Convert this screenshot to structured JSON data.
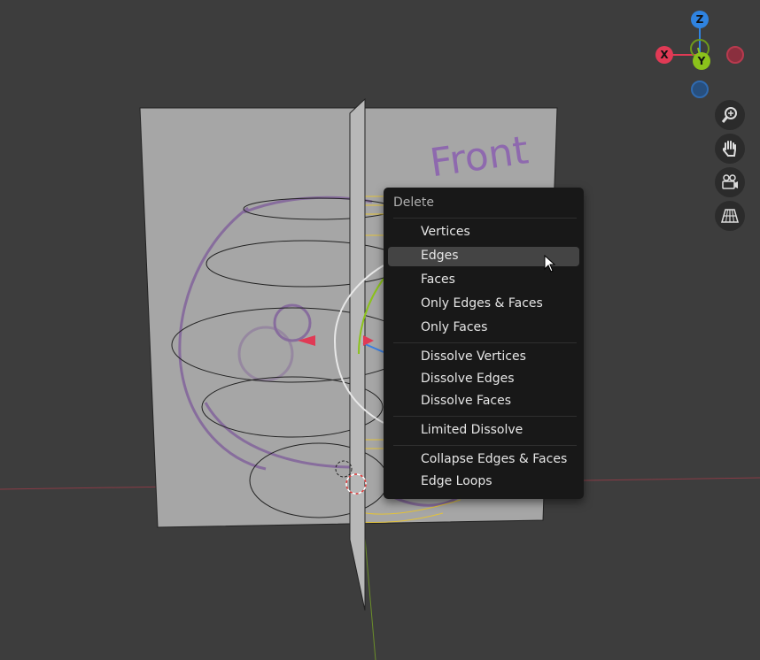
{
  "menu": {
    "title": "Delete",
    "items": [
      {
        "label": "Vertices"
      },
      {
        "label": "Edges",
        "highlighted": true
      },
      {
        "label": "Faces"
      },
      {
        "label": "Only Edges & Faces"
      },
      {
        "label": "Only Faces"
      },
      {
        "label": "Dissolve Vertices"
      },
      {
        "label": "Dissolve Edges"
      },
      {
        "label": "Dissolve Faces"
      },
      {
        "label": "Limited Dissolve"
      },
      {
        "label": "Collapse Edges & Faces"
      },
      {
        "label": "Edge Loops"
      }
    ]
  },
  "gizmo": {
    "x_label": "X",
    "y_label": "Y",
    "z_label": "Z",
    "colors": {
      "x": "#e03a55",
      "y": "#8bc21b",
      "z": "#2f83e0"
    }
  },
  "nav_buttons": [
    "zoom-icon",
    "hand-pan-icon",
    "camera-icon",
    "perspective-grid-icon"
  ],
  "sketch_text": "Front",
  "colors": {
    "viewport_bg": "#3d3d3d",
    "menu_bg": "#181818",
    "menu_highlight": "#444444"
  }
}
